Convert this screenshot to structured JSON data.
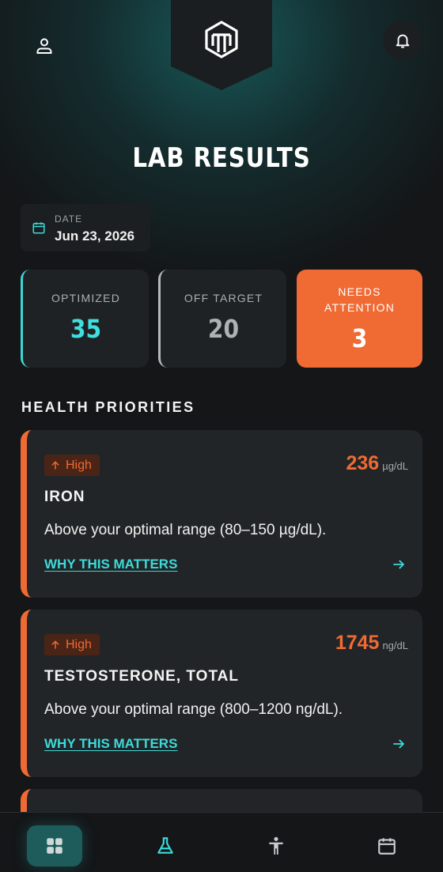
{
  "page": {
    "title": "LAB RESULTS"
  },
  "date": {
    "label": "DATE",
    "value": "Jun 23, 2026"
  },
  "stats": [
    {
      "label": "OPTIMIZED",
      "value": "35",
      "color": "#40dede"
    },
    {
      "label": "OFF TARGET",
      "value": "20",
      "color": "#aeb2b4"
    },
    {
      "label": "NEEDS ATTENTION",
      "value": "3",
      "color": "#f06a33"
    }
  ],
  "section": {
    "title": "HEALTH PRIORITIES"
  },
  "priorities": [
    {
      "badge": "High",
      "name": "IRON",
      "value": "236",
      "unit": "µg/dL",
      "description": "Above your optimal range (80–150 µg/dL).",
      "link": "WHY THIS MATTERS"
    },
    {
      "badge": "High",
      "name": "TESTOSTERONE, TOTAL",
      "value": "1745",
      "unit": "ng/dL",
      "description": "Above your optimal range (800–1200 ng/dL).",
      "link": "WHY THIS MATTERS"
    }
  ],
  "icons": {
    "profile": "user-icon",
    "notifications": "bell-icon",
    "logo": "shield-logo-icon",
    "date": "calendar-icon",
    "badge": "arrow-up-icon",
    "link_arrow": "arrow-right-icon",
    "nav": [
      "dashboard-icon",
      "flask-icon",
      "body-icon",
      "calendar-icon"
    ]
  },
  "colors": {
    "accent": "#3ddada",
    "alert": "#f06a33",
    "background": "#141618",
    "card": "#222527"
  }
}
